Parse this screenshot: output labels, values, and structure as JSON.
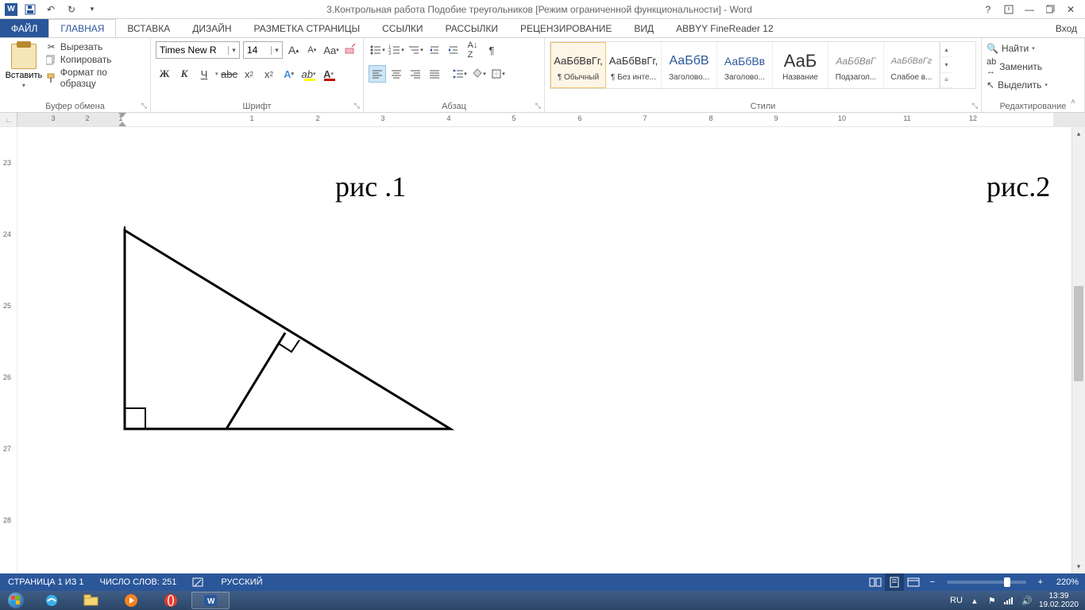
{
  "titlebar": {
    "title": "3.Контрольная работа Подобие треугольников [Режим ограниченной функциональности] - Word"
  },
  "tabs": {
    "file": "ФАЙЛ",
    "items": [
      "ГЛАВНАЯ",
      "ВСТАВКА",
      "ДИЗАЙН",
      "РАЗМЕТКА СТРАНИЦЫ",
      "ССЫЛКИ",
      "РАССЫЛКИ",
      "РЕЦЕНЗИРОВАНИЕ",
      "ВИД",
      "ABBYY FineReader 12"
    ],
    "login": "Вход"
  },
  "ribbon": {
    "clipboard": {
      "paste": "Вставить",
      "cut": "Вырезать",
      "copy": "Копировать",
      "format_painter": "Формат по образцу",
      "group_label": "Буфер обмена"
    },
    "font": {
      "family": "Times New R",
      "size": "14",
      "group_label": "Шрифт",
      "bold": "Ж",
      "italic": "К",
      "underline": "Ч",
      "strike": "abc"
    },
    "paragraph": {
      "group_label": "Абзац"
    },
    "styles": {
      "group_label": "Стили",
      "items": [
        {
          "preview": "АаБбВвГг,",
          "name": "¶ Обычный"
        },
        {
          "preview": "АаБбВвГг,",
          "name": "¶ Без инте..."
        },
        {
          "preview": "АаБбВ",
          "name": "Заголово..."
        },
        {
          "preview": "АаБбВв",
          "name": "Заголово..."
        },
        {
          "preview": "АаБ",
          "name": "Название"
        },
        {
          "preview": "АаБбВвГ",
          "name": "Подзагол..."
        },
        {
          "preview": "АаБбВвГг",
          "name": "Слабое в..."
        }
      ]
    },
    "editing": {
      "find": "Найти",
      "replace": "Заменить",
      "select": "Выделить",
      "group_label": "Редактирование"
    }
  },
  "ruler": {
    "h_numbers": [
      "3",
      "2",
      "1",
      "1",
      "2",
      "3",
      "4",
      "5",
      "6",
      "7",
      "8",
      "9",
      "10",
      "11",
      "12"
    ],
    "v_numbers": [
      "23",
      "24",
      "25",
      "26",
      "27",
      "28"
    ]
  },
  "document": {
    "fig1": "рис .1",
    "fig2": "рис.2"
  },
  "statusbar": {
    "page": "СТРАНИЦА 1 ИЗ 1",
    "words": "ЧИСЛО СЛОВ: 251",
    "lang": "РУССКИЙ",
    "zoom": "220%"
  },
  "taskbar": {
    "lang": "RU",
    "time": "13:39",
    "date": "19.02.2020"
  }
}
